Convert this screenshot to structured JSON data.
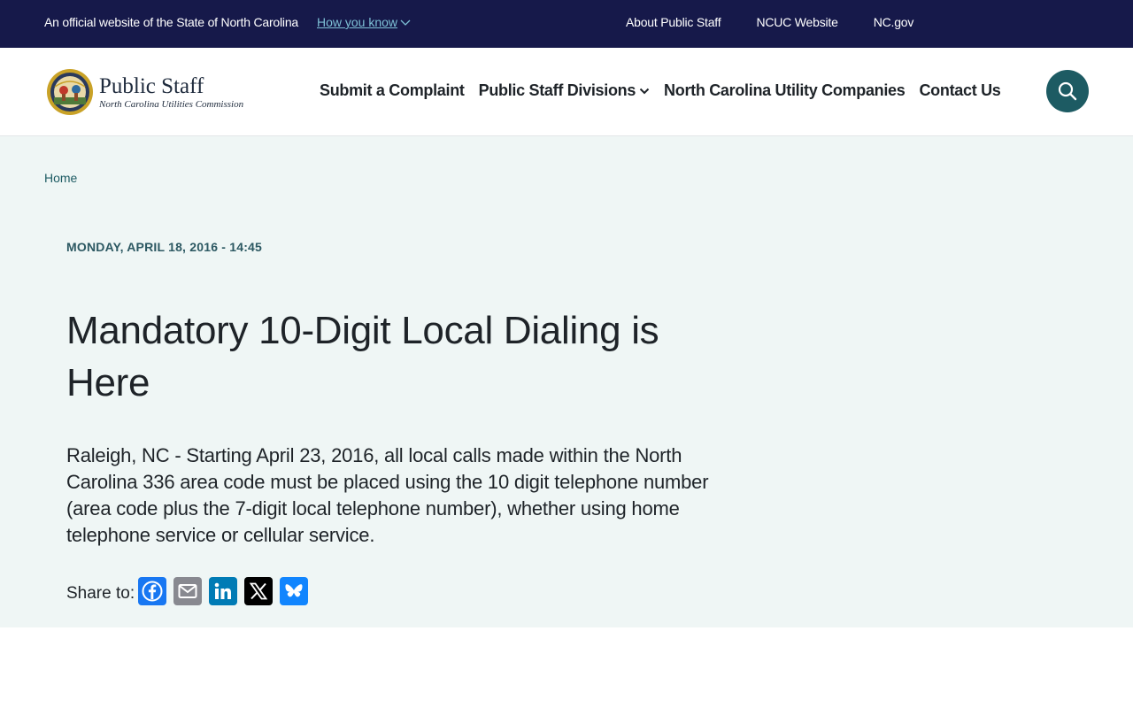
{
  "banner": {
    "official_text": "An official website of the State of North Carolina",
    "how_you_know": "How you know",
    "links": [
      "About Public Staff",
      "NCUC Website",
      "NC.gov"
    ]
  },
  "logo": {
    "title": "Public Staff",
    "subtitle": "North Carolina Utilities Commission"
  },
  "nav": {
    "items": [
      "Submit a Complaint",
      "Public Staff Divisions",
      "North Carolina Utility Companies",
      "Contact Us"
    ]
  },
  "search": {
    "icon": "search-icon"
  },
  "breadcrumb": {
    "home": "Home"
  },
  "article": {
    "date": "MONDAY, APRIL 18, 2016 - 14:45",
    "title": "Mandatory 10-Digit Local Dialing is Here",
    "body": "Raleigh, NC - Starting April 23, 2016, all local calls made within the North Carolina 336 area code must be placed using the 10 digit telephone number (area code plus the 7-digit local telephone number), whether using home telephone service or cellular service."
  },
  "share": {
    "label": "Share to:",
    "services": [
      {
        "name": "Facebook",
        "icon": "facebook-icon",
        "color": "#1877f2"
      },
      {
        "name": "Email",
        "icon": "email-icon",
        "color": "#888990"
      },
      {
        "name": "LinkedIn",
        "icon": "linkedin-icon",
        "color": "#007bb5"
      },
      {
        "name": "X",
        "icon": "x-icon",
        "color": "#000000"
      },
      {
        "name": "Bluesky",
        "icon": "bluesky-icon",
        "color": "#1185fe"
      }
    ]
  },
  "colors": {
    "banner_bg": "#16194a",
    "accent": "#1d5b63",
    "content_bg": "#eff6f5"
  }
}
